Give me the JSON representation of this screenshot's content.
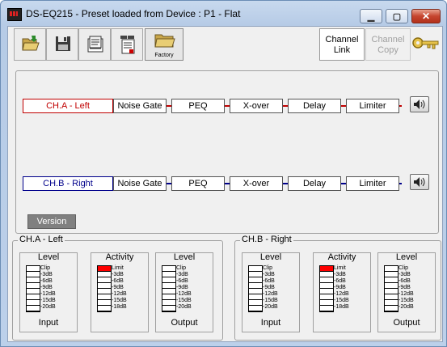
{
  "window": {
    "title": "DS-EQ215 - Preset loaded from Device : P1 - Flat",
    "close_label": "✕",
    "maximize_label": "▢",
    "minimize_label": "▁"
  },
  "toolbar": {
    "factory_label": "Factory",
    "channel_link_label": "Channel Link",
    "channel_copy_label": "Channel Copy"
  },
  "chain": {
    "channel_a": {
      "name": "CH.A - Left",
      "color": "#c00000",
      "blocks": [
        "Noise Gate",
        "PEQ",
        "X-over",
        "Delay",
        "Limiter"
      ]
    },
    "channel_b": {
      "name": "CH.B - Right",
      "color": "#00008b",
      "blocks": [
        "Noise Gate",
        "PEQ",
        "X-over",
        "Delay",
        "Limiter"
      ]
    },
    "version_label": "Version"
  },
  "meters": {
    "level_title": "Level",
    "activity_title": "Activity",
    "input_label": "Input",
    "output_label": "Output",
    "level_scale": [
      "Clip",
      "-3dB",
      "-6dB",
      "-9dB",
      "-12dB",
      "-15dB",
      "-20dB"
    ],
    "activity_scale": [
      "Limit",
      "-3dB",
      "-6dB",
      "-9dB",
      "-12dB",
      "-15dB",
      "-18dB"
    ],
    "channel_a_title": "CH.A - Left",
    "channel_b_title": "CH.B - Right",
    "activity_lit_color": "#ff0000"
  }
}
